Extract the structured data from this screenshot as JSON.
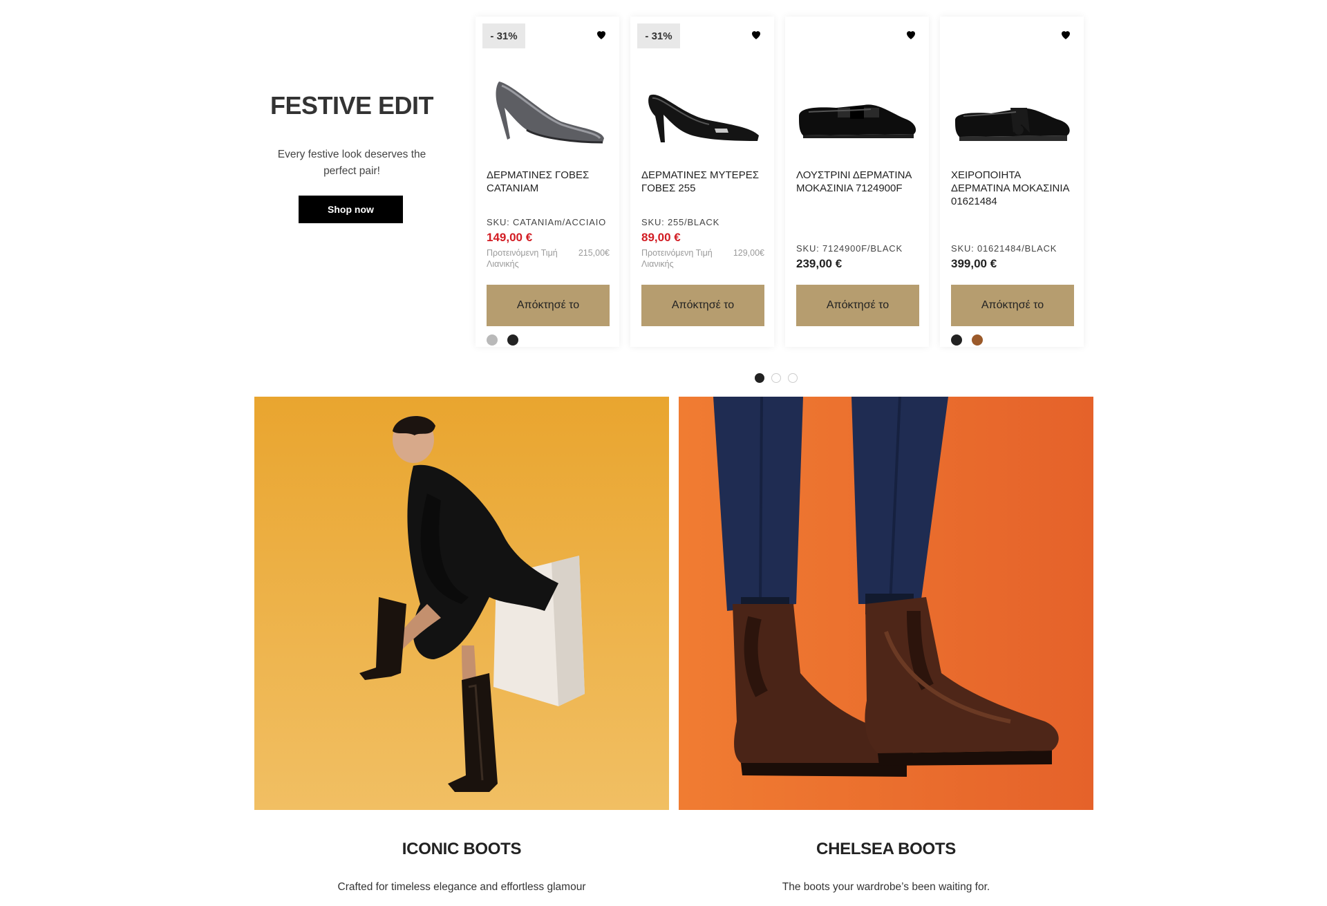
{
  "promo": {
    "title": "FESTIVE EDIT",
    "subtitle": "Every festive look deserves the perfect pair!",
    "button": "Shop now"
  },
  "products": [
    {
      "badge": "- 31%",
      "name": "ΔΕΡΜΑΤΙΝΕΣ ΓΟΒΕΣ CATANIAm",
      "sku": "SKU: CATANIAm/ACCIAIO",
      "price": "149,00 €",
      "rrp_label": "Προτεινόμενη Τιμή Λιανικής",
      "rrp_value": "215,00€",
      "button": "Απόκτησέ το",
      "swatches": [
        "#b9b9b9",
        "#222222"
      ],
      "icon": "heart-icon"
    },
    {
      "badge": "- 31%",
      "name": "ΔΕΡΜΑΤΙΝΕΣ ΜΥΤΕΡΕΣ ΓΟΒΕΣ 255",
      "sku": "SKU: 255/BLACK",
      "price": "89,00 €",
      "rrp_label": "Προτεινόμενη Τιμή Λιανικής",
      "rrp_value": "129,00€",
      "button": "Απόκτησέ το",
      "swatches": [],
      "icon": "heart-icon"
    },
    {
      "badge": "",
      "name": "ΛΟΥΣΤΡΙΝΙ ΔΕΡΜΑΤΙΝΑ ΜΟΚΑΣΙΝΙΑ 7124900F",
      "sku": "SKU: 7124900F/BLACK",
      "price": "239,00 €",
      "rrp_label": "",
      "rrp_value": "",
      "button": "Απόκτησέ το",
      "swatches": [],
      "icon": "heart-icon"
    },
    {
      "badge": "",
      "name": "ΧΕΙΡΟΠΟΙΗΤΑ ΔΕΡΜΑΤΙΝΑ ΜΟΚΑΣΙΝΙΑ 01621484",
      "sku": "SKU: 01621484/BLACK",
      "price": "399,00 €",
      "rrp_label": "",
      "rrp_value": "",
      "button": "Απόκτησέ το",
      "swatches": [
        "#222222",
        "#9b5a2a"
      ],
      "icon": "heart-icon"
    }
  ],
  "pagination": {
    "total": 3,
    "active": 1
  },
  "tiles": [
    {
      "title": "ICONIC BOOTS",
      "subtitle": "Crafted for timeless elegance and effortless glamour"
    },
    {
      "title": "CHELSEA BOOTS",
      "subtitle": "The boots your wardrobe’s been waiting for."
    }
  ],
  "colors": {
    "accent_button": "#b69d6f",
    "sale_price": "#d21c23",
    "promo_button": "#000000"
  }
}
